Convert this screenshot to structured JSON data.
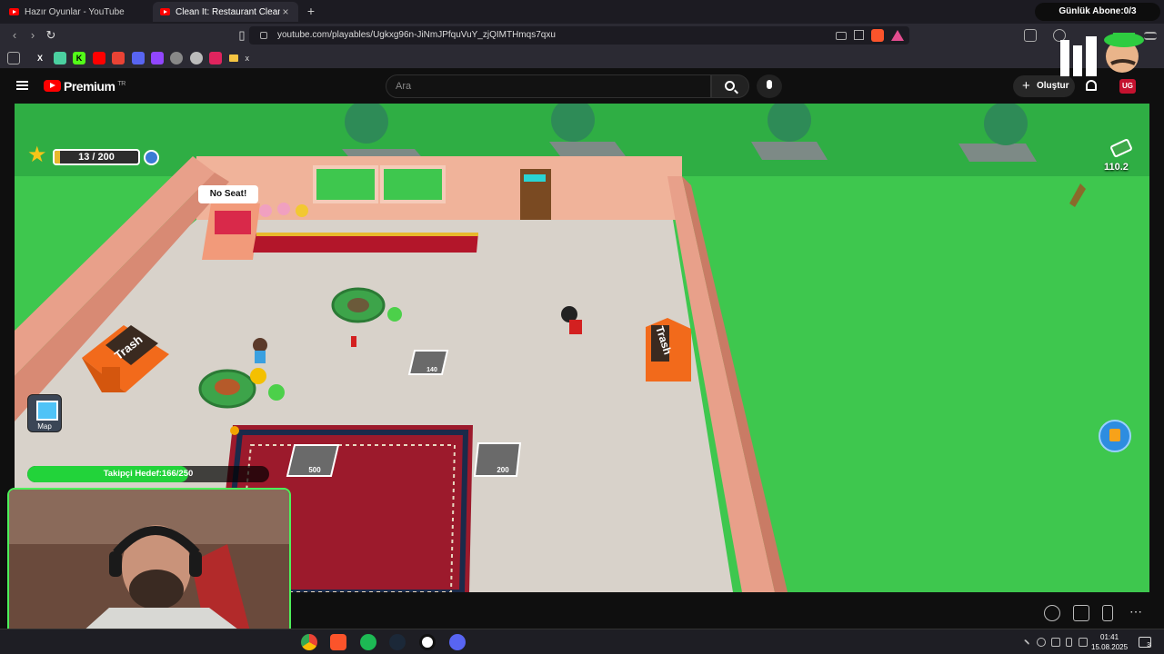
{
  "browser": {
    "tabs": [
      {
        "title": "Hazır Oyunlar - YouTube",
        "active": false
      },
      {
        "title": "Clean It: Restaurant Cleanup - Yo",
        "active": true
      }
    ],
    "url": "youtube.com/playables/Ugkxg96n-JiNmJPfquVuY_zjQIMTHmqs7qxu",
    "bookmarks": [
      {
        "icon": "x-icon",
        "label": ""
      },
      {
        "icon": "folder-icon",
        "label": "x"
      }
    ],
    "subscriber_goal": "Günlük Abone:0/3"
  },
  "youtube": {
    "brand": "Premium",
    "region": "TR",
    "search_placeholder": "Ara",
    "create_label": "Oluştur"
  },
  "game": {
    "level_progress": "13 / 200",
    "level_fill": 0.065,
    "money": "110.2",
    "speech_bubble": "No Seat!",
    "trash_left": "Trash",
    "trash_right": "Trash",
    "unlock_tiles": [
      {
        "price": "140"
      },
      {
        "price": "500"
      },
      {
        "price": "200"
      }
    ],
    "map_label": "Map",
    "follower_goal": "Takipçi Hedef:166/250",
    "follower_fill": 0.664
  },
  "taskbar": {
    "time": "01:41",
    "date": "15.08.2025",
    "notifications": "3"
  },
  "colors": {
    "grass": "#3ec74e",
    "floor": "#d8d2ca",
    "wall": "#e8a08a",
    "carpet": "#9c1a2c",
    "trash": "#f26a1b",
    "accent_green": "#4df05a"
  }
}
